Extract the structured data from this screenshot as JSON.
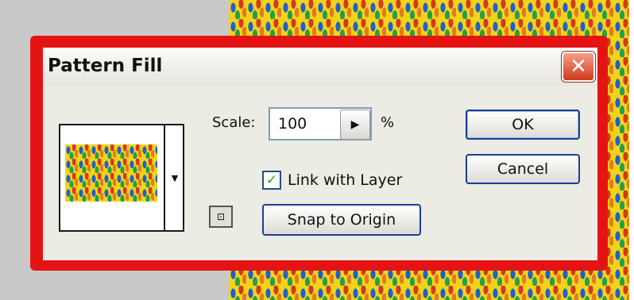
{
  "dialog": {
    "title": "Pattern Fill",
    "close_glyph": "✕"
  },
  "scale": {
    "label": "Scale:",
    "value": "100",
    "unit": "%",
    "arrow_glyph": "▶"
  },
  "link_with_layer": {
    "label": "Link with Layer",
    "checked": true,
    "check_glyph": "✓"
  },
  "buttons": {
    "snap_to_origin": "Snap to Origin",
    "ok": "OK",
    "cancel": "Cancel"
  },
  "pattern_preview": {
    "dropdown_glyph": "▼",
    "icon": "pattern-swatch-icon"
  },
  "new_preset_glyph": "⊡",
  "colors": {
    "highlight_frame": "#e41414",
    "dialog_bg": "#ecebe4",
    "close_button": "#d1391c",
    "button_border": "#1c3f94",
    "checkmark": "#21a121"
  }
}
